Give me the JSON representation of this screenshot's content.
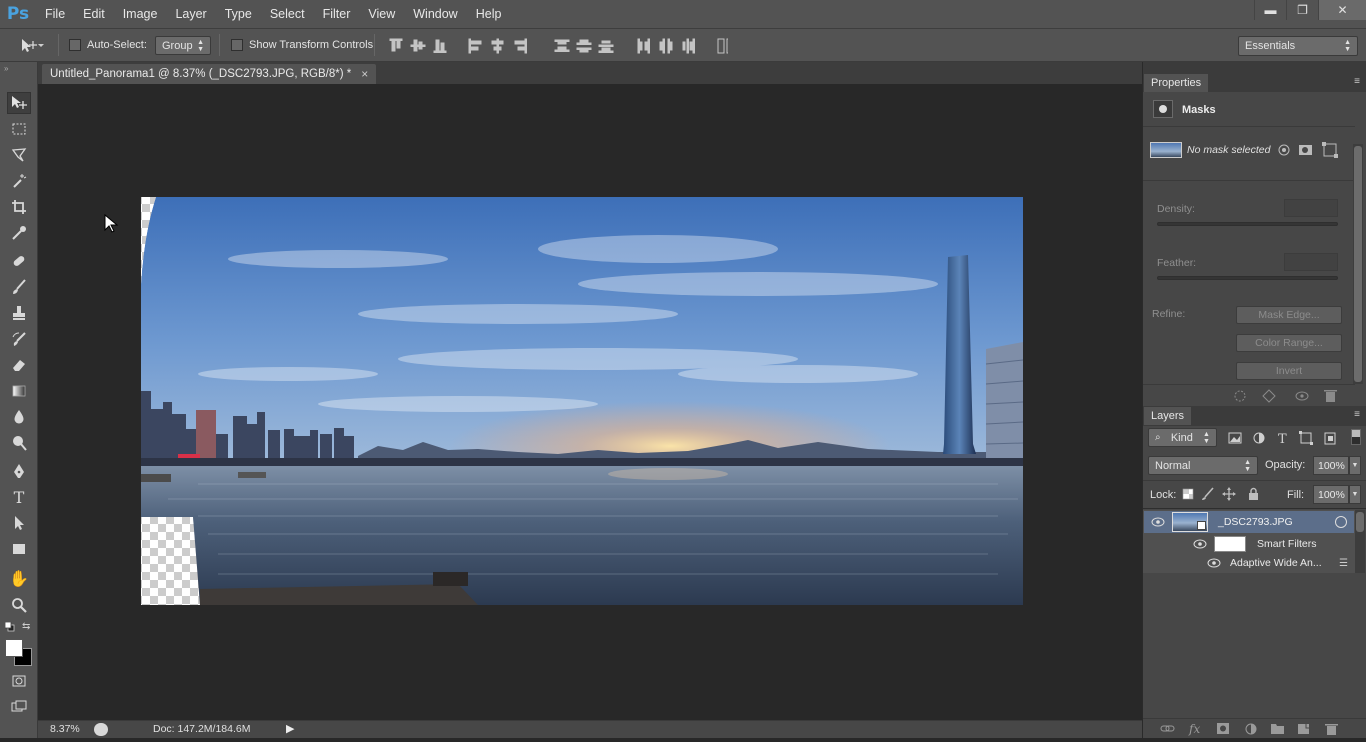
{
  "app": {
    "logo": "Ps"
  },
  "menu": [
    "File",
    "Edit",
    "Image",
    "Layer",
    "Type",
    "Select",
    "Filter",
    "View",
    "Window",
    "Help"
  ],
  "window_controls": {
    "minimize": "▬",
    "restore": "❐",
    "close": "✕"
  },
  "options_bar": {
    "auto_select_label": "Auto-Select:",
    "auto_select_target": "Group",
    "show_transform_label": "Show Transform Controls",
    "workspace": "Essentials"
  },
  "document": {
    "tab_title": "Untitled_Panorama1 @ 8.37% (_DSC2793.JPG, RGB/8*) *",
    "tab_close": "×"
  },
  "status": {
    "zoom": "8.37%",
    "doc_info": "Doc: 147.2M/184.6M"
  },
  "properties": {
    "tab": "Properties",
    "section": "Masks",
    "no_mask": "No mask selected",
    "density_label": "Density:",
    "feather_label": "Feather:",
    "refine_label": "Refine:",
    "mask_edge": "Mask Edge...",
    "color_range": "Color Range...",
    "invert": "Invert"
  },
  "layers": {
    "tab": "Layers",
    "filter_kind": "Kind",
    "blend_mode": "Normal",
    "opacity_label": "Opacity:",
    "opacity_value": "100%",
    "lock_label": "Lock:",
    "fill_label": "Fill:",
    "fill_value": "100%",
    "items": [
      {
        "name": "_DSC2793.JPG"
      },
      {
        "name": "Smart Filters"
      },
      {
        "name": "Adaptive Wide An..."
      }
    ]
  },
  "colors": {
    "accent_blue": "#4aa3e0",
    "panel_bg": "#474747",
    "chrome_bg": "#535353",
    "canvas_bg": "#282828"
  }
}
